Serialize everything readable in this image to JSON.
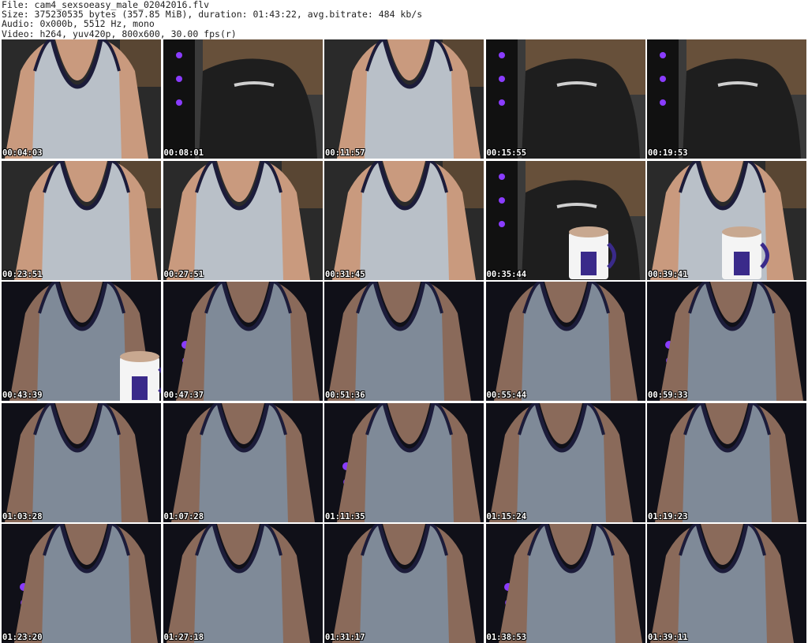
{
  "header": {
    "file_line": "File: cam4_sexsoeasy_male_02042016.flv",
    "size_line": "Size: 375230535 bytes (357.85 MiB), duration: 01:43:22, avg.bitrate: 484 kb/s",
    "audio_line": "Audio: 0x000b, 5512 Hz, mono",
    "video_line": "Video: h264, yuv420p, 800x600, 30.00 fps(r)"
  },
  "thumbnails": [
    {
      "timestamp": "00:04:03",
      "scene": "person"
    },
    {
      "timestamp": "00:08:01",
      "scene": "chair"
    },
    {
      "timestamp": "00:11:57",
      "scene": "person"
    },
    {
      "timestamp": "00:15:55",
      "scene": "chair"
    },
    {
      "timestamp": "00:19:53",
      "scene": "chair"
    },
    {
      "timestamp": "00:23:51",
      "scene": "person"
    },
    {
      "timestamp": "00:27:51",
      "scene": "person"
    },
    {
      "timestamp": "00:31:45",
      "scene": "person"
    },
    {
      "timestamp": "00:35:44",
      "scene": "chair-mug"
    },
    {
      "timestamp": "00:39:41",
      "scene": "person-mug"
    },
    {
      "timestamp": "00:43:39",
      "scene": "person-dark-mug"
    },
    {
      "timestamp": "00:47:37",
      "scene": "person-dark"
    },
    {
      "timestamp": "00:51:36",
      "scene": "person-dark"
    },
    {
      "timestamp": "00:55:44",
      "scene": "person-dark"
    },
    {
      "timestamp": "00:59:33",
      "scene": "person-dark"
    },
    {
      "timestamp": "01:03:28",
      "scene": "person-dark"
    },
    {
      "timestamp": "01:07:28",
      "scene": "person-dark"
    },
    {
      "timestamp": "01:11:35",
      "scene": "person-dark"
    },
    {
      "timestamp": "01:15:24",
      "scene": "person-dark"
    },
    {
      "timestamp": "01:19:23",
      "scene": "person-dark"
    },
    {
      "timestamp": "01:23:20",
      "scene": "person-dark"
    },
    {
      "timestamp": "01:27:18",
      "scene": "person-dark"
    },
    {
      "timestamp": "01:31:17",
      "scene": "person-dark"
    },
    {
      "timestamp": "01:38:53",
      "scene": "person-dark"
    },
    {
      "timestamp": "01:39:11",
      "scene": "person-dark"
    }
  ],
  "colors": {
    "tank_top": "#b9c0c8",
    "tank_trim": "#1c1c3a",
    "skin": "#c99a7e",
    "skin_dark": "#8a6a5a",
    "chair": "#1e1e1e",
    "bookshelf": "#7a5a3a",
    "purple_light": "#8a3cff",
    "background_dark": "#101018"
  }
}
